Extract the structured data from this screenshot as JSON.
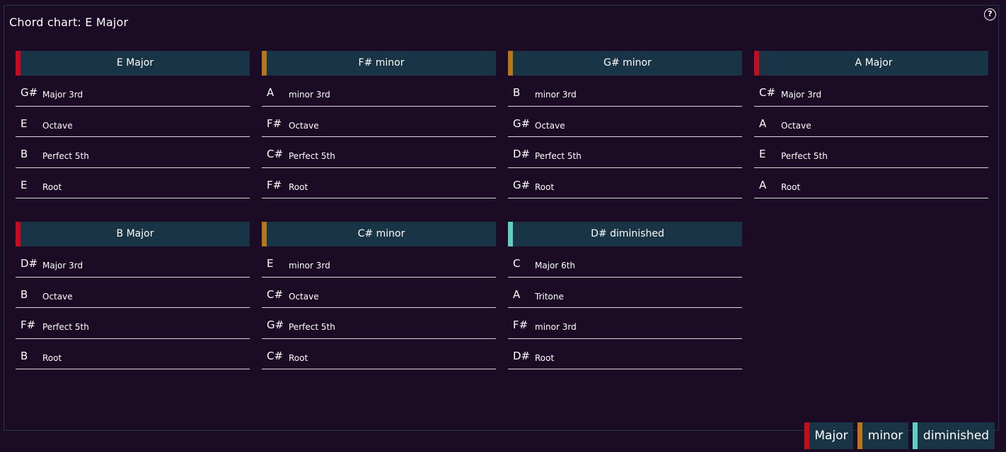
{
  "title": "Chord chart: E Major",
  "help_label": "?",
  "colors": {
    "Major": "#c80c1e",
    "minor": "#b8761a",
    "diminished": "#5fcfc4"
  },
  "chords": [
    {
      "name": "E Major",
      "quality": "Major",
      "notes": [
        {
          "note": "G#",
          "interval": "Major 3rd"
        },
        {
          "note": "E",
          "interval": "Octave"
        },
        {
          "note": "B",
          "interval": "Perfect 5th"
        },
        {
          "note": "E",
          "interval": "Root"
        }
      ]
    },
    {
      "name": "F# minor",
      "quality": "minor",
      "notes": [
        {
          "note": "A",
          "interval": "minor 3rd"
        },
        {
          "note": "F#",
          "interval": "Octave"
        },
        {
          "note": "C#",
          "interval": "Perfect 5th"
        },
        {
          "note": "F#",
          "interval": "Root"
        }
      ]
    },
    {
      "name": "G# minor",
      "quality": "minor",
      "notes": [
        {
          "note": "B",
          "interval": "minor 3rd"
        },
        {
          "note": "G#",
          "interval": "Octave"
        },
        {
          "note": "D#",
          "interval": "Perfect 5th"
        },
        {
          "note": "G#",
          "interval": "Root"
        }
      ]
    },
    {
      "name": "A Major",
      "quality": "Major",
      "notes": [
        {
          "note": "C#",
          "interval": "Major 3rd"
        },
        {
          "note": "A",
          "interval": "Octave"
        },
        {
          "note": "E",
          "interval": "Perfect 5th"
        },
        {
          "note": "A",
          "interval": "Root"
        }
      ]
    },
    {
      "name": "B Major",
      "quality": "Major",
      "notes": [
        {
          "note": "D#",
          "interval": "Major 3rd"
        },
        {
          "note": "B",
          "interval": "Octave"
        },
        {
          "note": "F#",
          "interval": "Perfect 5th"
        },
        {
          "note": "B",
          "interval": "Root"
        }
      ]
    },
    {
      "name": "C# minor",
      "quality": "minor",
      "notes": [
        {
          "note": "E",
          "interval": "minor 3rd"
        },
        {
          "note": "C#",
          "interval": "Octave"
        },
        {
          "note": "G#",
          "interval": "Perfect 5th"
        },
        {
          "note": "C#",
          "interval": "Root"
        }
      ]
    },
    {
      "name": "D# diminished",
      "quality": "diminished",
      "notes": [
        {
          "note": "C",
          "interval": "Major 6th"
        },
        {
          "note": "A",
          "interval": "Tritone"
        },
        {
          "note": "F#",
          "interval": "minor 3rd"
        },
        {
          "note": "D#",
          "interval": "Root"
        }
      ]
    }
  ],
  "legend": [
    {
      "label": "Major",
      "quality": "Major"
    },
    {
      "label": "minor",
      "quality": "minor"
    },
    {
      "label": "diminished",
      "quality": "diminished"
    }
  ]
}
